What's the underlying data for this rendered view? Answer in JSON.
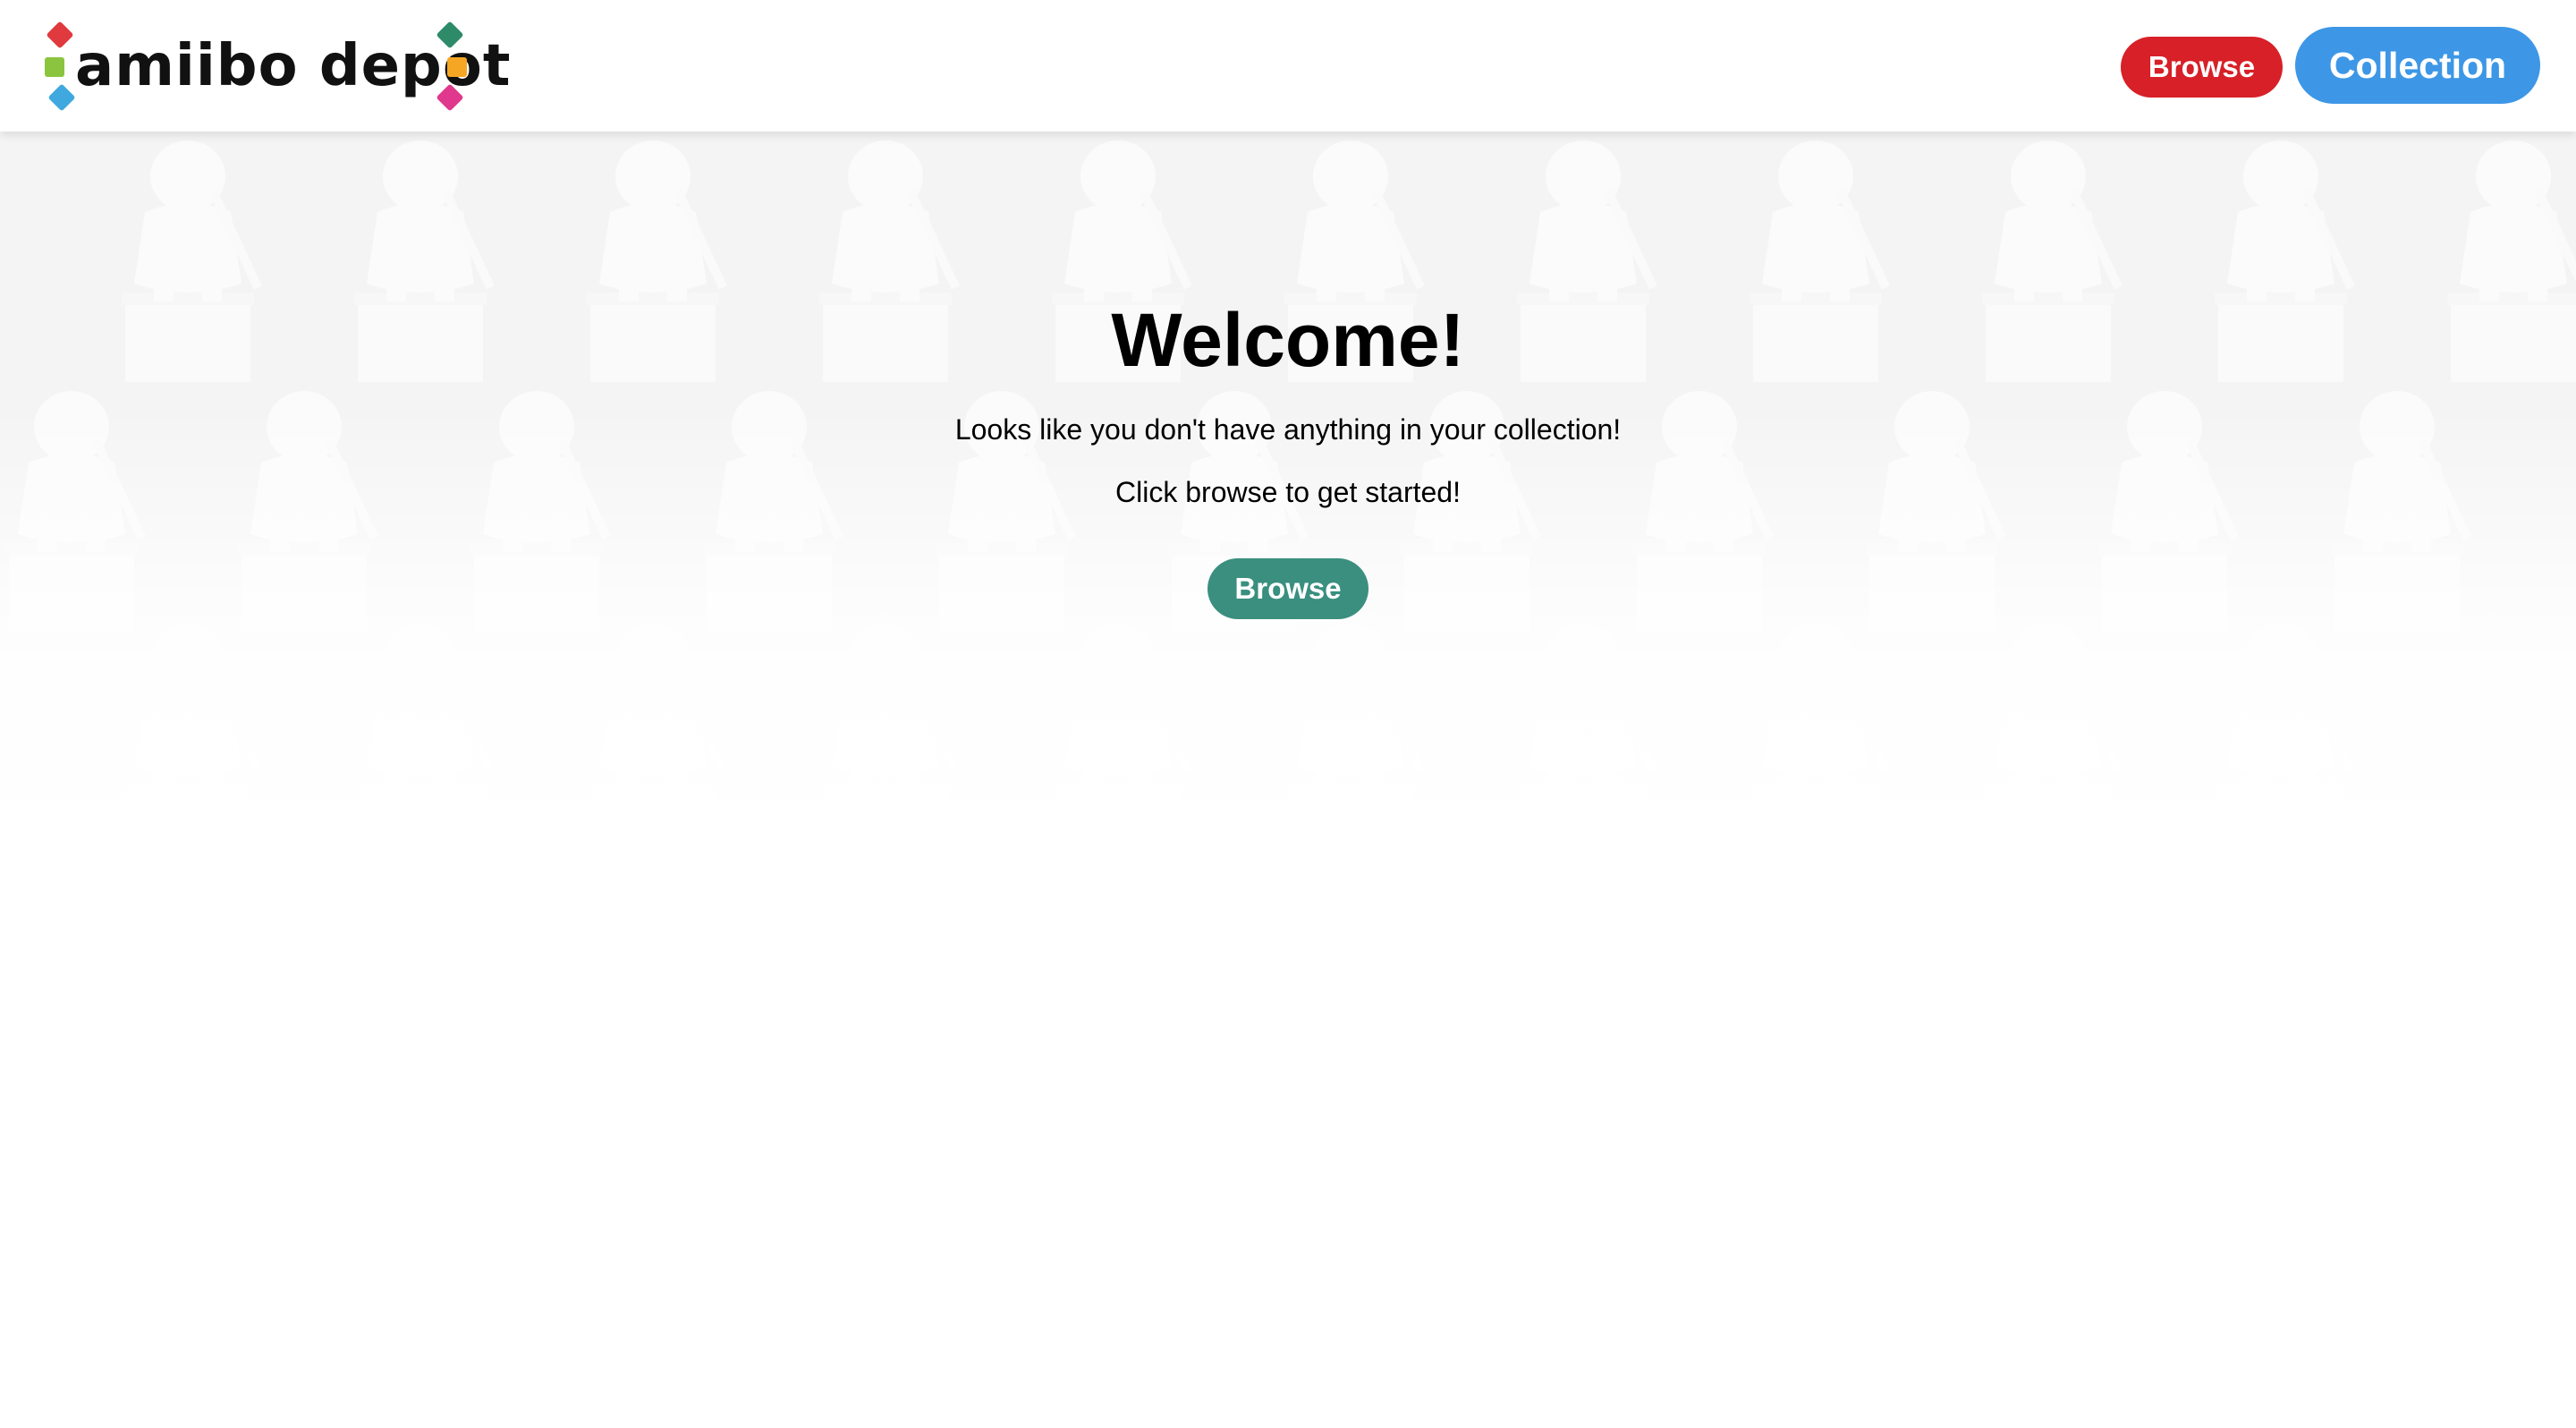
{
  "header": {
    "logo_text": "amiibo depot",
    "nav": {
      "browse_label": "Browse",
      "collection_label": "Collection"
    }
  },
  "main": {
    "title": "Welcome!",
    "message_line1": "Looks like you don't have anything in your collection!",
    "message_line2": "Click browse to get started!",
    "browse_button_label": "Browse"
  },
  "colors": {
    "nav_browse": "#d72027",
    "nav_collection": "#3d97e6",
    "cta_browse": "#3a8f7f",
    "logo_accents": [
      "#e03a3e",
      "#8bc53f",
      "#3fa9df",
      "#2e8b6a",
      "#f5a623",
      "#e0388c"
    ]
  },
  "icons": {
    "logo_marks": "colored-dash-icons",
    "hero_background": "amiibo-figure-silhouettes"
  }
}
